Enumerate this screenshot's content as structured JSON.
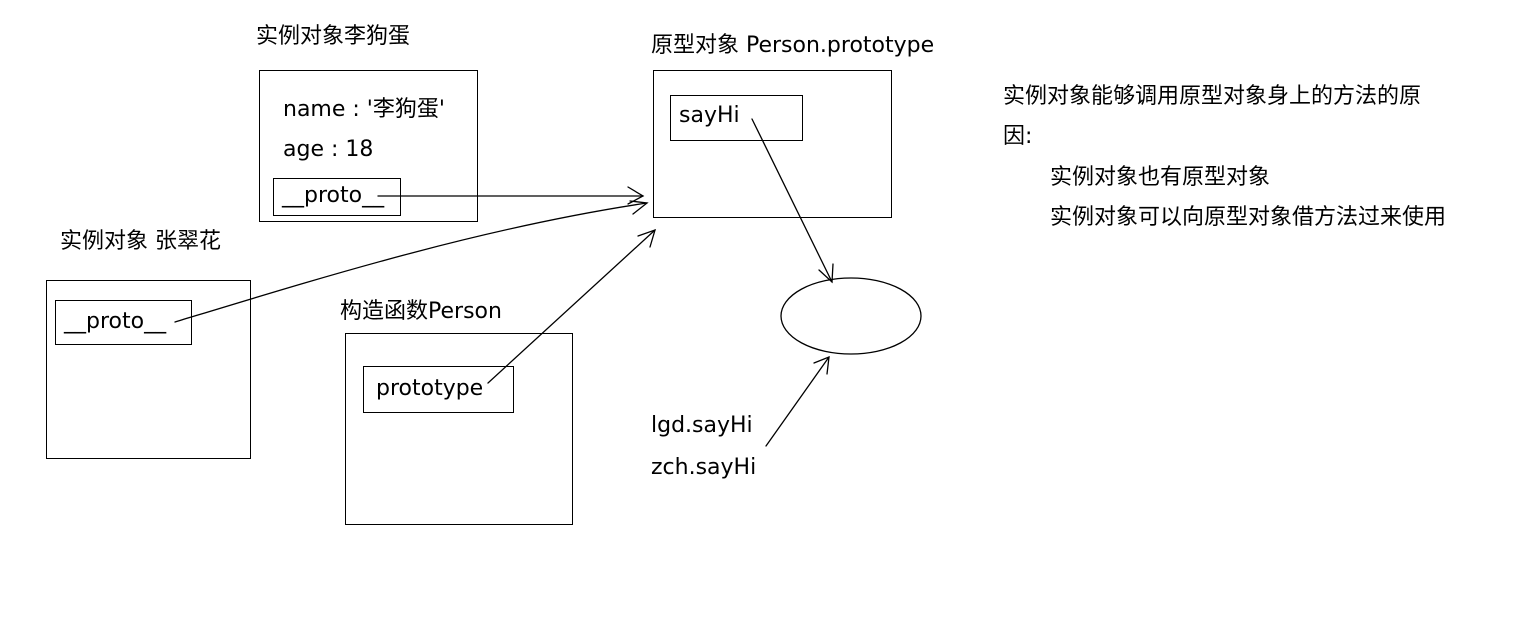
{
  "instance_lgd": {
    "title": "实例对象李狗蛋",
    "name_line": "name : '李狗蛋'",
    "age_line": "age : 18",
    "proto_label": "__proto__"
  },
  "instance_zch": {
    "title": "实例对象 张翠花",
    "proto_label": "__proto__"
  },
  "constructor": {
    "title": "构造函数Person",
    "prototype_label": "prototype"
  },
  "prototype_object": {
    "title": "原型对象 Person.prototype",
    "method_label": "sayHi"
  },
  "calls": {
    "lgd": "lgd.sayHi",
    "zch": "zch.sayHi"
  },
  "explanation": {
    "line1": "实例对象能够调用原型对象身上的方法的原",
    "line2": "因:",
    "line3": "实例对象也有原型对象",
    "line4": "实例对象可以向原型对象借方法过来使用"
  },
  "colors": {
    "stroke": "#000000",
    "background": "#ffffff"
  }
}
